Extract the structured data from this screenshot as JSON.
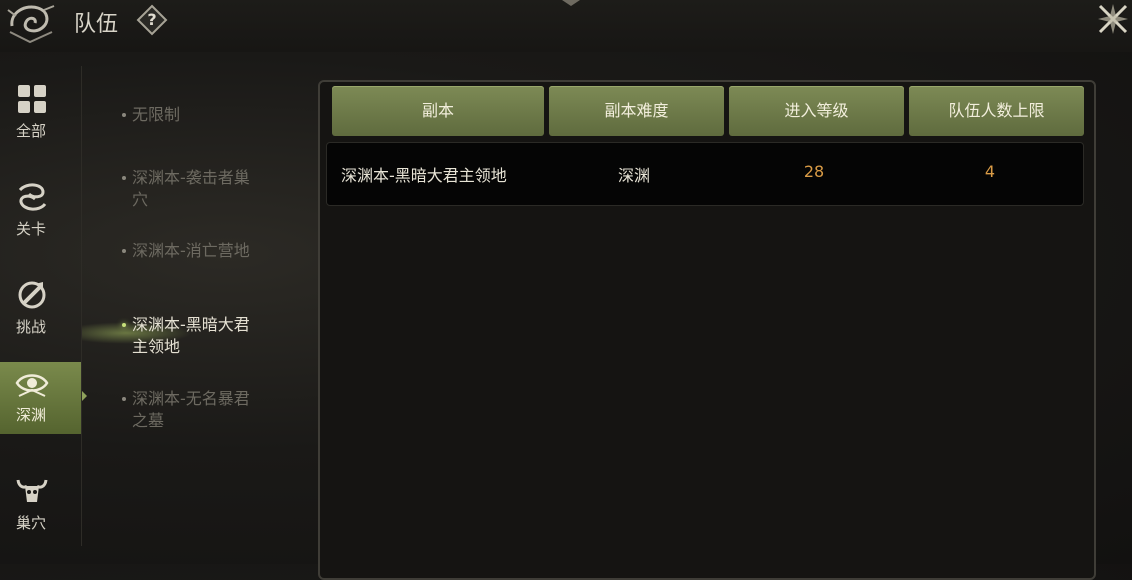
{
  "header": {
    "title": "队伍",
    "help_label": "?"
  },
  "categories": [
    {
      "icon": "grid-icon",
      "label": "全部"
    },
    {
      "icon": "swirl-icon",
      "label": "关卡"
    },
    {
      "icon": "sword-icon",
      "label": "挑战"
    },
    {
      "icon": "eye-icon",
      "label": "深渊",
      "active": true
    },
    {
      "icon": "bull-skull-icon",
      "label": "巢穴"
    }
  ],
  "subcategories": [
    {
      "label": "无限制"
    },
    {
      "label": "深渊本-袭击者巢穴"
    },
    {
      "label": "深渊本-消亡营地"
    },
    {
      "label": "深渊本-黑暗大君主领地",
      "active": true
    },
    {
      "label": "深渊本-无名暴君之墓"
    }
  ],
  "table": {
    "columns": [
      "副本",
      "副本难度",
      "进入等级",
      "队伍人数上限"
    ],
    "rows": [
      {
        "name": "深渊本-黑暗大君主领地",
        "difficulty": "深渊",
        "level": "28",
        "max_members": "4"
      }
    ]
  },
  "colors": {
    "accent_green": "#6f7c47",
    "value_orange": "#d99b46",
    "active_tab": "#6a7a3e"
  }
}
